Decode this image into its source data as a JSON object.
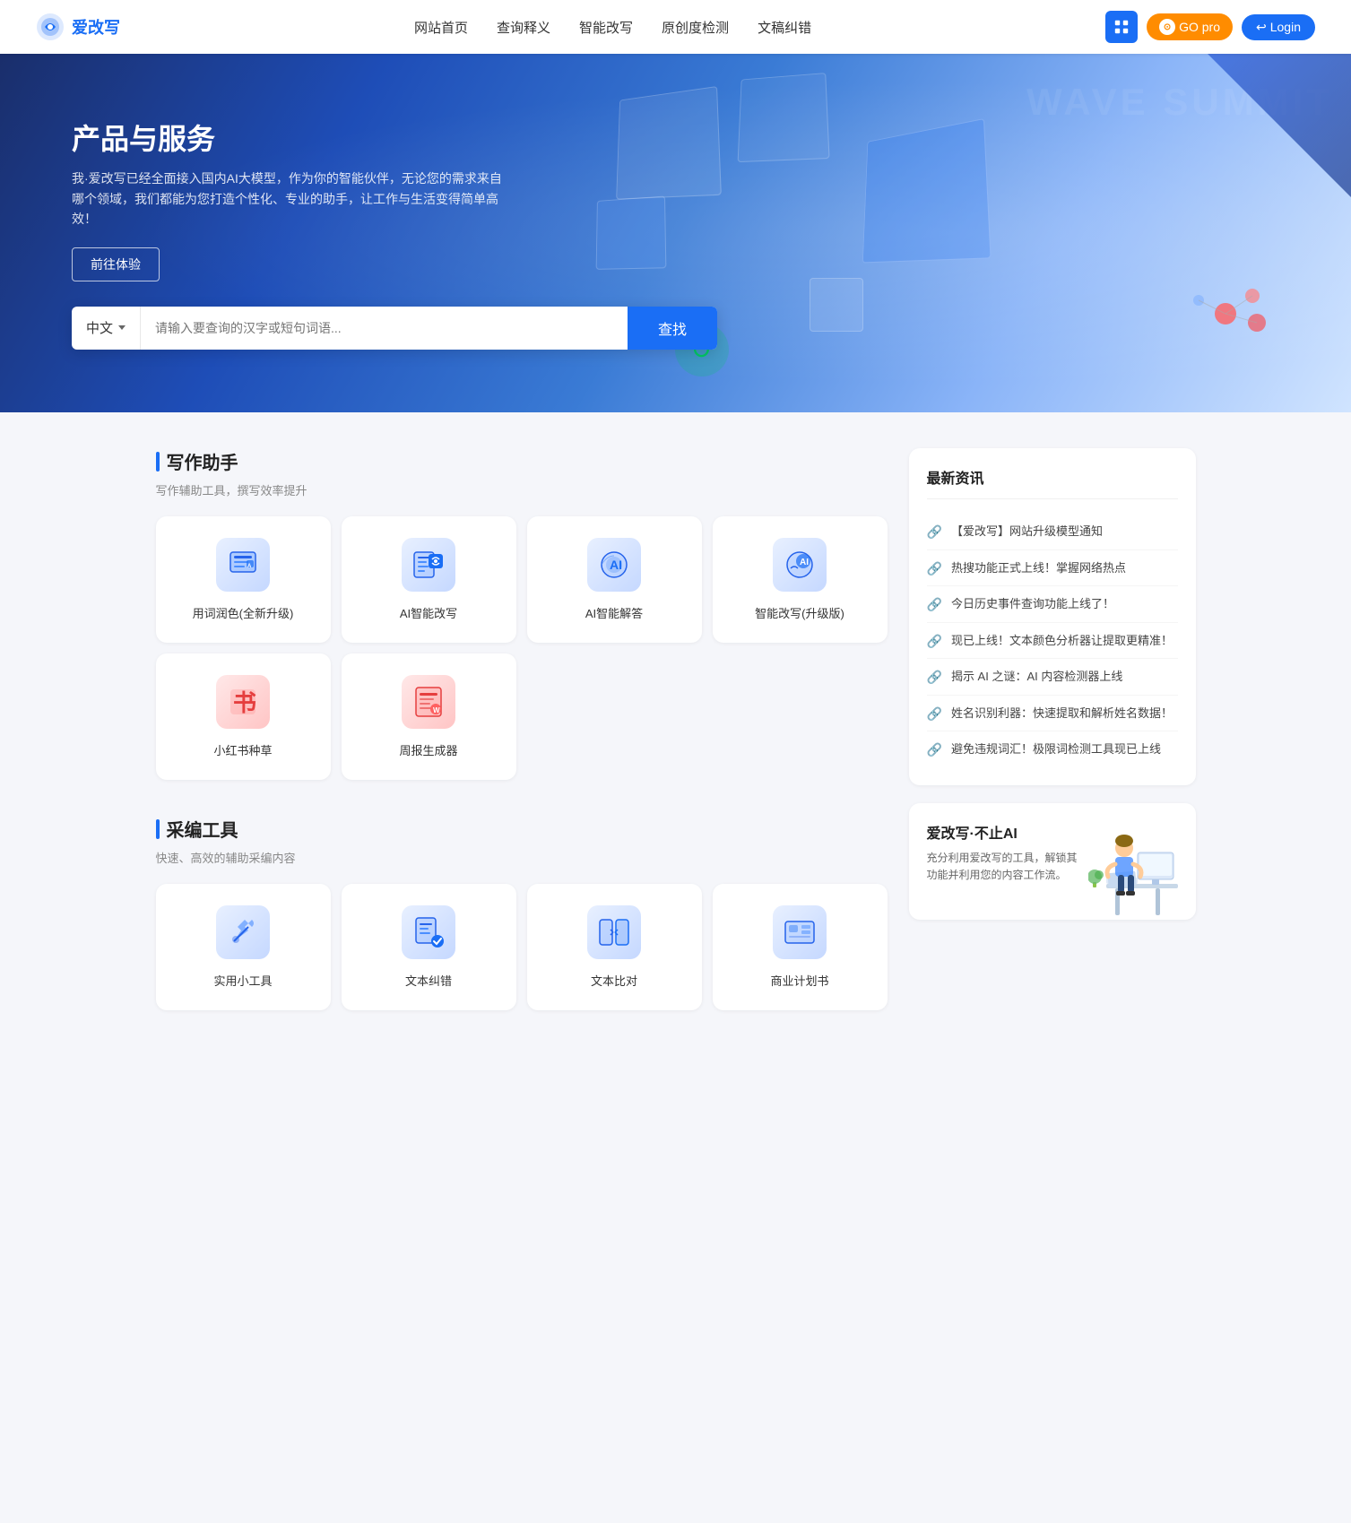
{
  "header": {
    "logo_text": "爱改写",
    "nav": [
      {
        "label": "网站首页",
        "id": "home"
      },
      {
        "label": "查询释义",
        "id": "query"
      },
      {
        "label": "智能改写",
        "id": "rewrite"
      },
      {
        "label": "原创度检测",
        "id": "originality"
      },
      {
        "label": "文稿纠错",
        "id": "proofread"
      }
    ],
    "btn_grid_label": "apps",
    "btn_go_label": "GO pro",
    "btn_login_label": "Login"
  },
  "hero": {
    "title": "产品与服务",
    "subtitle": "我·爱改写已经全面接入国内AI大模型，作为你的智能伙伴，无论您的需求来自哪个领域，我们都能为您打造个性化、专业的助手，让工作与生活变得简单高效！",
    "btn_trial": "前往体验",
    "search": {
      "lang": "中文",
      "placeholder": "请输入要查询的汉字或短句词语...",
      "btn": "查找"
    }
  },
  "writing_tools": {
    "section_title": "写作助手",
    "section_sub": "写作辅助工具，撰写效率提升",
    "tools": [
      {
        "id": "word-color",
        "label": "用词润色(全新升级)",
        "icon": "writing"
      },
      {
        "id": "ai-rewrite",
        "label": "AI智能改写",
        "icon": "ai"
      },
      {
        "id": "ai-answer",
        "label": "AI智能解答",
        "icon": "ai2"
      },
      {
        "id": "smart-rewrite",
        "label": "智能改写(升级版)",
        "icon": "ai3"
      },
      {
        "id": "xiaohongshu",
        "label": "小红书种草",
        "icon": "book"
      },
      {
        "id": "weekly-report",
        "label": "周报生成器",
        "icon": "report"
      }
    ]
  },
  "editing_tools": {
    "section_title": "采编工具",
    "section_sub": "快速、高效的辅助采编内容",
    "tools": [
      {
        "id": "useful-tools",
        "label": "实用小工具",
        "icon": "tool"
      },
      {
        "id": "text-check",
        "label": "文本纠错",
        "icon": "check"
      },
      {
        "id": "text-compare",
        "label": "文本比对",
        "icon": "compare"
      },
      {
        "id": "business-plan",
        "label": "商业计划书",
        "icon": "plan"
      }
    ]
  },
  "news": {
    "title": "最新资讯",
    "items": [
      {
        "text": "【爱改写】网站升级模型通知"
      },
      {
        "text": "热搜功能正式上线！掌握网络热点"
      },
      {
        "text": "今日历史事件查询功能上线了！"
      },
      {
        "text": "现已上线！文本颜色分析器让提取更精准！"
      },
      {
        "text": "揭示 AI 之谜：AI 内容检测器上线"
      },
      {
        "text": "姓名识别利器：快速提取和解析姓名数据！"
      },
      {
        "text": "避免违规词汇！极限词检测工具现已上线"
      }
    ]
  },
  "promo": {
    "title": "爱改写·不止AI",
    "subtitle": "充分利用爱改写的工具，解锁其功能并利用您的内容工作流。"
  }
}
